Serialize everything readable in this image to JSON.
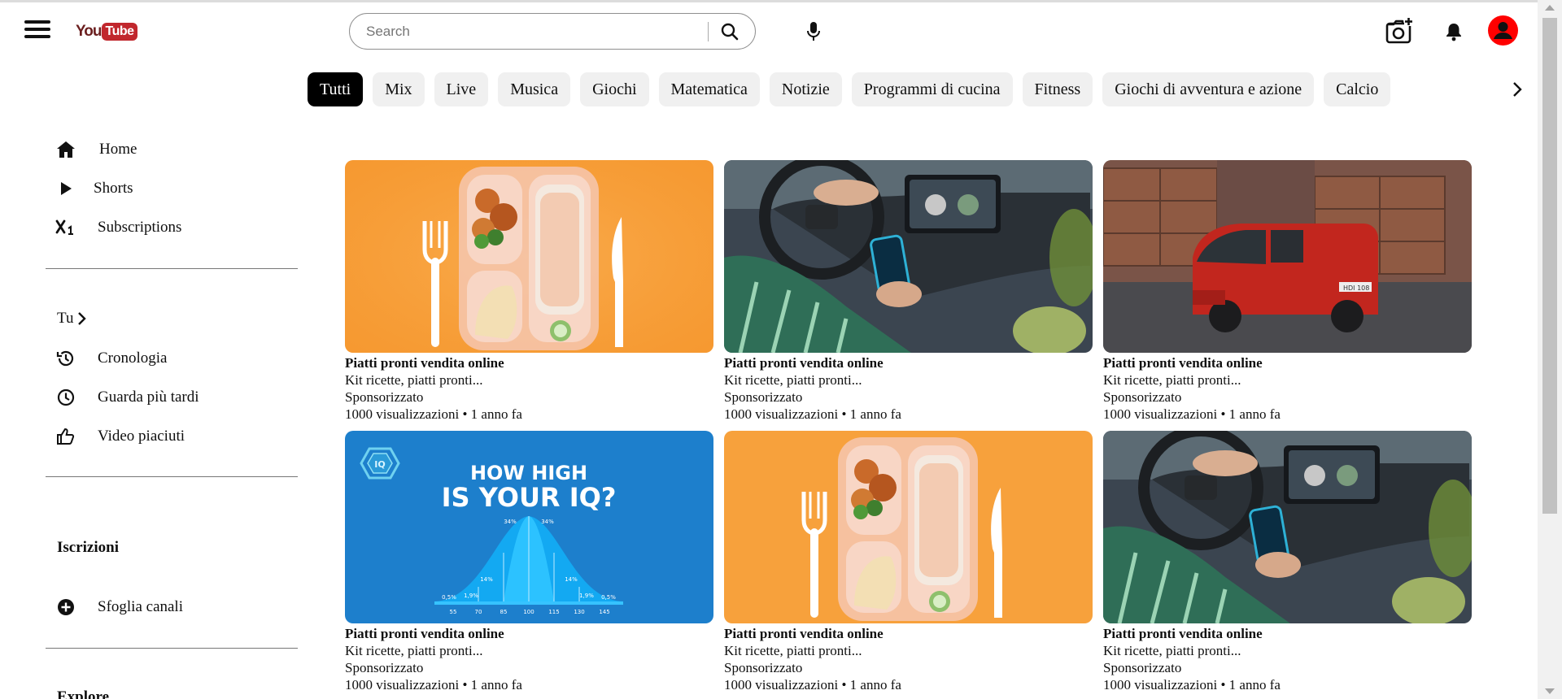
{
  "header": {
    "logo_you": "You",
    "logo_tube": "Tube",
    "search_placeholder": "Search"
  },
  "chips": [
    "Tutti",
    "Mix",
    "Live",
    "Musica",
    "Giochi",
    "Matematica",
    "Notizie",
    "Programmi di cucina",
    "Fitness",
    "Giochi di avventura e azione",
    "Calcio"
  ],
  "sidebar": {
    "main": [
      {
        "label": "Home",
        "icon": "home-icon"
      },
      {
        "label": "Shorts",
        "icon": "shorts-icon"
      },
      {
        "label": "Subscriptions",
        "icon": "subscriptions-icon"
      }
    ],
    "you_label": "Tu",
    "you_items": [
      {
        "label": "Cronologia",
        "icon": "history-icon"
      },
      {
        "label": "Guarda più tardi",
        "icon": "watch-later-icon"
      },
      {
        "label": "Video piaciuti",
        "icon": "like-icon"
      }
    ],
    "subscriptions_title": "Iscrizioni",
    "browse_channels": "Sfoglia canali",
    "explore_title": "Explore"
  },
  "videos": [
    {
      "title": "Piatti pronti vendita online",
      "subtitle": "Kit ricette, piatti pronti...",
      "channel": "Sponsorizzato",
      "meta": "1000 visualizzazioni • 1 anno fa",
      "thumb": "food"
    },
    {
      "title": "Piatti pronti vendita online",
      "subtitle": "Kit ricette, piatti pronti...",
      "channel": "Sponsorizzato",
      "meta": "1000 visualizzazioni • 1 anno fa",
      "thumb": "car"
    },
    {
      "title": "Piatti pronti vendita online",
      "subtitle": "Kit ricette, piatti pronti...",
      "channel": "Sponsorizzato",
      "meta": "1000 visualizzazioni • 1 anno fa",
      "thumb": "van"
    },
    {
      "title": "Piatti pronti vendita online",
      "subtitle": "Kit ricette, piatti pronti...",
      "channel": "Sponsorizzato",
      "meta": "1000 visualizzazioni • 1 anno fa",
      "thumb": "iq"
    },
    {
      "title": "Piatti pronti vendita online",
      "subtitle": "Kit ricette, piatti pronti...",
      "channel": "Sponsorizzato",
      "meta": "1000 visualizzazioni • 1 anno fa",
      "thumb": "food"
    },
    {
      "title": "Piatti pronti vendita online",
      "subtitle": "Kit ricette, piatti pronti...",
      "channel": "Sponsorizzato",
      "meta": "1000 visualizzazioni • 1 anno fa",
      "thumb": "car"
    }
  ],
  "iq_thumb": {
    "headline_1": "HOW HIGH",
    "headline_2": "IS YOUR IQ?",
    "badge": "IQ",
    "ticks": [
      "55",
      "70",
      "85",
      "100",
      "115",
      "130",
      "145"
    ],
    "percents": [
      "0,5%",
      "1,9%",
      "14%",
      "34%",
      "34%",
      "14%",
      "1,9%",
      "0,5%"
    ]
  },
  "van_plate": "HDI 108",
  "colors": {
    "accent_red": "#ff0000",
    "chip_active_bg": "#000000",
    "chip_bg": "#f0f0f0",
    "food_bg": "#f7a13c",
    "iq_bg": "#1d7fcc"
  }
}
